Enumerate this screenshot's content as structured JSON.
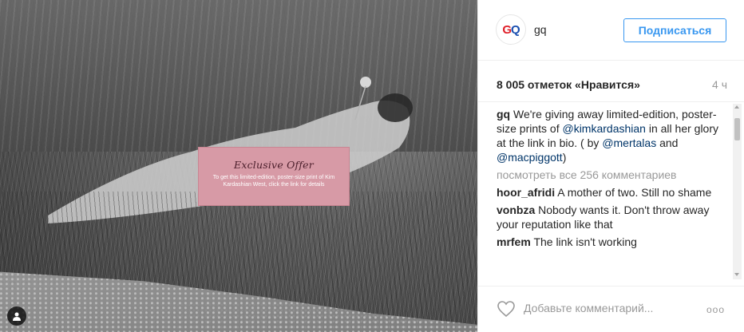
{
  "post": {
    "offer": {
      "title": "Exclusive Offer",
      "text": "To get this limited-edition, poster-size print of Kim Kardashian West, click the link for details"
    }
  },
  "header": {
    "avatar_letters": [
      "G",
      "Q"
    ],
    "username": "gq",
    "follow_label": "Подписаться"
  },
  "stats": {
    "likes": "8 005 отметок «Нравится»",
    "time": "4 ч"
  },
  "caption": {
    "user": "gq",
    "text_1": "We're giving away limited-edition, poster-size prints of ",
    "mention_1": "@kimkardashian",
    "text_2": " in all her glory at the link in bio. (",
    "glyph": "",
    "text_3": " by ",
    "mention_2": "@mertalas",
    "text_4": " and ",
    "mention_3": "@macpiggott",
    "text_5": ")"
  },
  "view_all": "посмотреть все 256 комментариев",
  "comments": [
    {
      "user": "hoor_afridi",
      "text": "A mother of two. Still no shame "
    },
    {
      "user": "vonbza",
      "text": "Nobody wants it. Don't throw away your reputation like that"
    },
    {
      "user": "mrfem",
      "text": "The link isn't working "
    }
  ],
  "footer": {
    "placeholder": "Добавьте комментарий...",
    "more": "ooo"
  },
  "colors": {
    "accent": "#3897f0",
    "mention": "#003569",
    "offer_bg": "#d79aa6"
  }
}
